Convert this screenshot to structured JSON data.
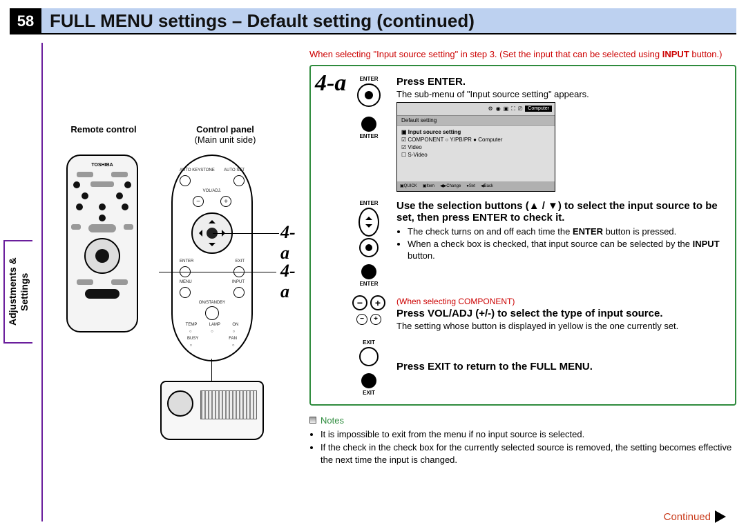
{
  "page_number": "58",
  "title": "FULL MENU settings – Default setting (continued)",
  "sidebar_tab": "Adjustments &\nSettings",
  "left": {
    "remote_label": "Remote control",
    "panel_label": "Control panel",
    "panel_sub": "(Main unit side)",
    "remote_brand": "TOSHIBA",
    "callout": "4-a",
    "panel_text": {
      "autokey": "AUTO\nKEYSTONE",
      "autoset": "AUTO\nSET",
      "voladj": "VOL/ADJ.",
      "enter": "ENTER",
      "exit": "EXIT",
      "menu": "MENU",
      "input": "INPUT",
      "standby": "ON/STANDBY",
      "temp": "TEMP",
      "lamp": "LAMP",
      "on": "ON",
      "busy": "BUSY",
      "fan": "FAN"
    }
  },
  "pre_note": {
    "line": "When selecting \"Input source setting\" in step 3. (Set the input that can be selected using ",
    "bold": "INPUT",
    "tail": " button.)"
  },
  "step": {
    "tag": "4-a",
    "s1": {
      "btn_top": "ENTER",
      "btn_bottom": "ENTER",
      "heading": "Press ENTER.",
      "body": "The sub-menu of \"Input source setting\" appears.",
      "submenu": {
        "top_chip": "Computer",
        "hdr": "Default setting",
        "row_title": "Input source setting",
        "rows": [
          "☑ COMPONENT    ○ Y/PB/PR    ● Computer",
          "☑ Video",
          "☐ S-Video"
        ],
        "foot": [
          "QUICK",
          "Item",
          "Change",
          "Set",
          "Back"
        ]
      }
    },
    "s2": {
      "btn_top": "ENTER",
      "btn_bottom": "ENTER",
      "heading": "Use the selection buttons (▲ / ▼) to select the input source to be set, then press ENTER to check it.",
      "bullets": [
        "The check turns on and off each time the ENTER button is pressed.",
        "When a check box is checked, that input source can be selected by the INPUT button."
      ]
    },
    "s3": {
      "redline": "(When selecting COMPONENT)",
      "heading": "Press VOL/ADJ (+/-) to select the type of input source.",
      "body": "The setting whose button is displayed in yellow is the one currently set.",
      "exit_label": "EXIT"
    },
    "s4": {
      "heading": "Press EXIT to return to the FULL MENU.",
      "exit_label": "EXIT"
    }
  },
  "notes": {
    "title": "Notes",
    "items": [
      "It is impossible to exit from the menu if no input source is selected.",
      "If the check in the check box for the currently selected source is removed, the setting becomes effective the next time the input is changed."
    ]
  },
  "continued": "Continued"
}
